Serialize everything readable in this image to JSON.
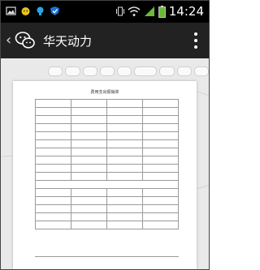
{
  "status_bar": {
    "time": "14:24",
    "icons": [
      "image-notification-icon",
      "cat-notification-icon",
      "bulb-notification-icon",
      "shield-notification-icon"
    ],
    "right_icons": [
      "vibrate-icon",
      "wifi-icon",
      "signal-icon",
      "battery-icon"
    ]
  },
  "app_bar": {
    "back_glyph": "‹",
    "title": "华天动力",
    "colors": {
      "background": "#222222",
      "text": "#ffffff"
    }
  },
  "toolbar": {
    "buttons": [
      "",
      "",
      "",
      "",
      "",
      "",
      "",
      "",
      ""
    ]
  },
  "document": {
    "title": "费用支出报销单",
    "rows": [
      [
        "",
        "",
        "",
        ""
      ],
      [
        "",
        "",
        "",
        ""
      ],
      [
        "",
        "",
        "",
        ""
      ],
      [
        "",
        "",
        "",
        ""
      ],
      [
        "",
        "",
        "",
        ""
      ],
      [
        "",
        "",
        "",
        ""
      ],
      [
        "",
        "",
        "",
        ""
      ],
      [
        "",
        "",
        "",
        ""
      ],
      [
        "",
        "",
        "",
        ""
      ],
      [
        "",
        "",
        "",
        ""
      ]
    ],
    "notice": ""
  }
}
